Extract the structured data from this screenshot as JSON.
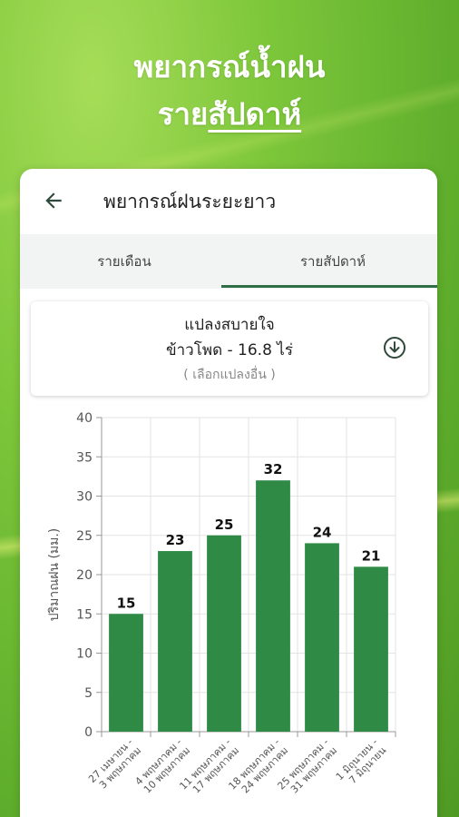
{
  "headline": {
    "line1": "พยากรณ์น้ำฝน",
    "line2_prefix": "ราย",
    "line2_emphasis": "สัปดาห์"
  },
  "appbar": {
    "title": "พยากรณ์ฝนระยะยาว",
    "back_icon": "arrow-left-icon"
  },
  "tabs": [
    {
      "label": "รายเดือน",
      "selected": false
    },
    {
      "label": "รายสัปดาห์",
      "selected": true
    }
  ],
  "plot": {
    "name": "แปลงสบายใจ",
    "crop_area": "ข้าวโพด - 16.8 ไร่",
    "select_link": "( เลือกแปลงอื่น )",
    "download_icon": "download-circle-icon"
  },
  "colors": {
    "accent": "#2f6d46",
    "bar": "#2f8a45",
    "background": "#7cc63a"
  },
  "chart_data": {
    "type": "bar",
    "ylabel": "ปริมาณฝน (มม.)",
    "xlabel": "",
    "ylim": [
      0,
      40
    ],
    "yticks": [
      0,
      5,
      10,
      15,
      20,
      25,
      30,
      35,
      40
    ],
    "grid": true,
    "categories": [
      "27 เมษายน - 3 พฤษภาคม",
      "4 พฤษภาคม - 10 พฤษภาคม",
      "11 พฤษภาคม - 17 พฤษภาคม",
      "18 พฤษภาคม - 24 พฤษภาคม",
      "25 พฤษภาคม - 31 พฤษภาคม",
      "1 มิถุนายน - 7 มิถุนายน"
    ],
    "category_lines": [
      [
        "27 เมษายน -",
        "3 พฤษภาคม"
      ],
      [
        "4 พฤษภาคม -",
        "10 พฤษภาคม"
      ],
      [
        "11 พฤษภาคม -",
        "17 พฤษภาคม"
      ],
      [
        "18 พฤษภาคม -",
        "24 พฤษภาคม"
      ],
      [
        "25 พฤษภาคม -",
        "31 พฤษภาคม"
      ],
      [
        "1 มิถุนายน -",
        "7 มิถุนายน"
      ]
    ],
    "values": [
      15,
      23,
      25,
      32,
      24,
      21
    ]
  }
}
